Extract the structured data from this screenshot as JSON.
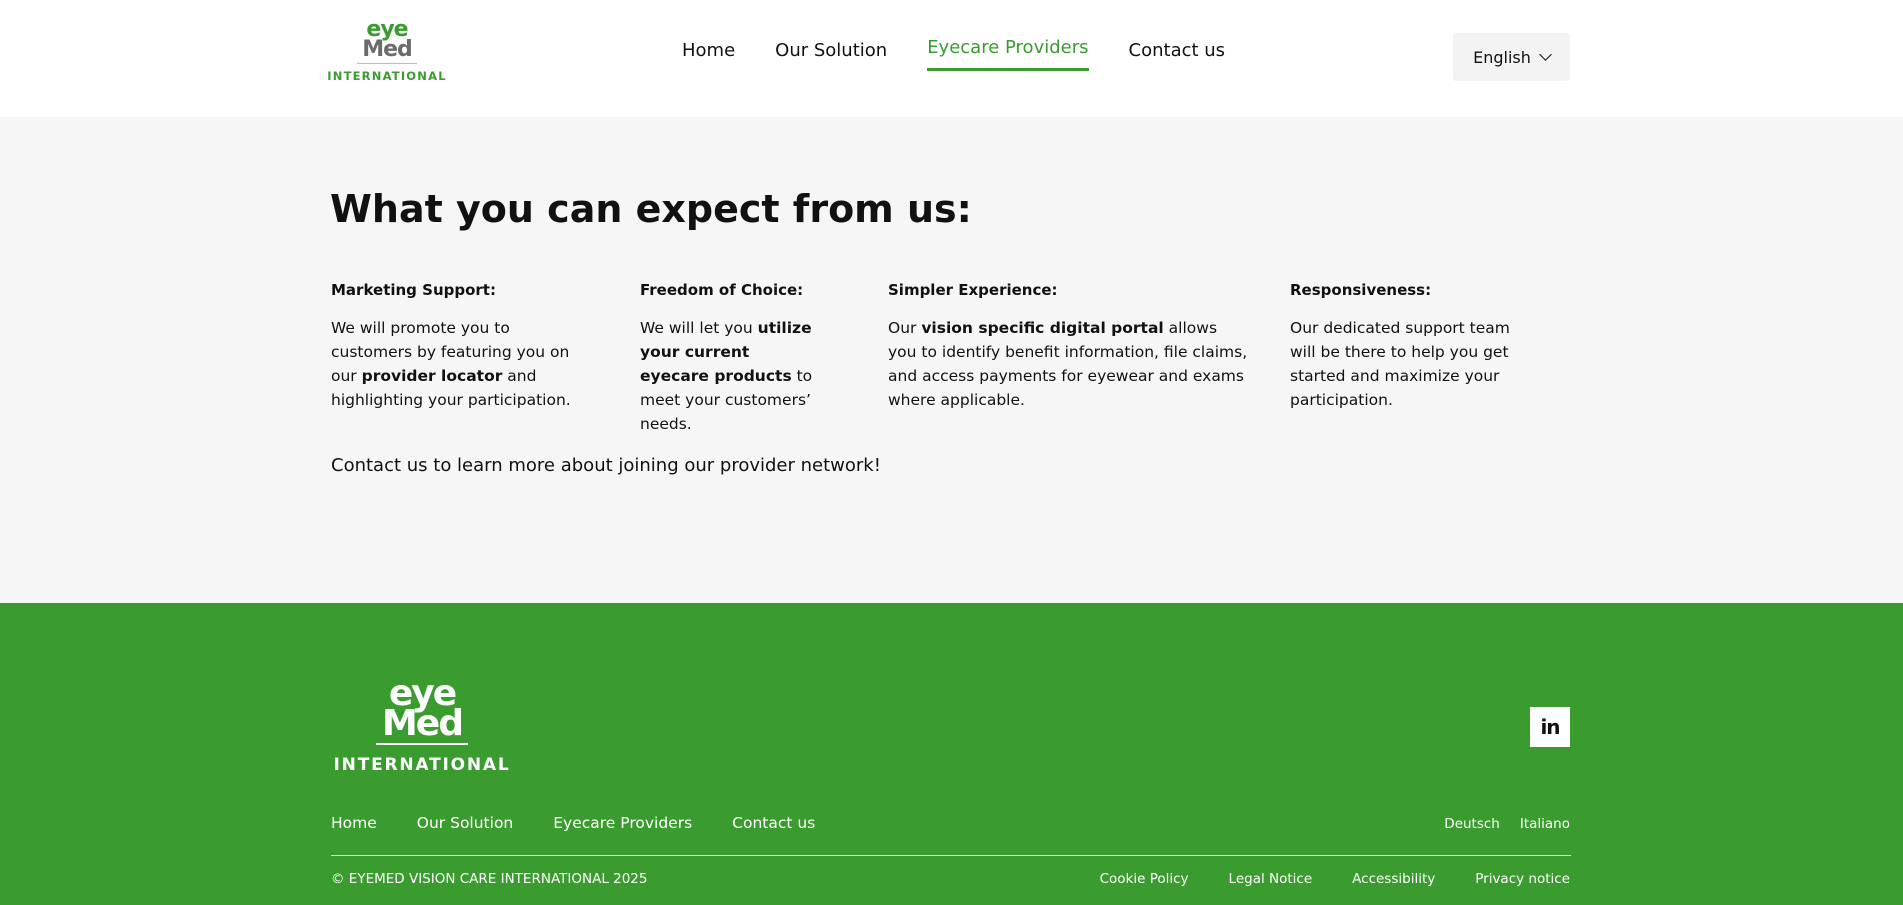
{
  "header": {
    "logo": {
      "line1": "eye",
      "line2": "Med",
      "line3": "INTERNATIONAL"
    },
    "nav": [
      {
        "label": "Home",
        "active": false
      },
      {
        "label": "Our Solution",
        "active": false
      },
      {
        "label": "Eyecare Providers",
        "active": true
      },
      {
        "label": "Contact us",
        "active": false
      }
    ],
    "language": {
      "selected": "English",
      "icon": "chevron-down-icon"
    }
  },
  "main": {
    "title": "What you can expect from us:",
    "columns": [
      {
        "heading": "Marketing Support:",
        "parts": [
          {
            "text": "We will promote you to customers by featuring you on our ",
            "bold": false
          },
          {
            "text": "provider locator",
            "bold": true
          },
          {
            "text": " and highlighting your participation.",
            "bold": false
          }
        ]
      },
      {
        "heading": "Freedom of Choice:",
        "parts": [
          {
            "text": "We will let you ",
            "bold": false
          },
          {
            "text": "utilize your current eyecare products",
            "bold": true
          },
          {
            "text": " to meet your customers’ needs.",
            "bold": false
          }
        ]
      },
      {
        "heading": "Simpler Experience:",
        "parts": [
          {
            "text": "Our ",
            "bold": false
          },
          {
            "text": "vision specific digital portal",
            "bold": true
          },
          {
            "text": " allows you to identify benefit information, file claims, and access payments for eyewear and exams where applicable.",
            "bold": false
          }
        ]
      },
      {
        "heading": "Responsiveness:",
        "parts": [
          {
            "text": "Our dedicated support team will be there to help you get started and maximize your participation.",
            "bold": false
          }
        ]
      }
    ],
    "cta": "Contact us to learn more about joining our provider network!"
  },
  "footer": {
    "logo": {
      "line1": "eye",
      "line2": "Med",
      "line3": "INTERNATIONAL"
    },
    "social": {
      "label": "in",
      "icon": "linkedin-icon"
    },
    "nav": [
      "Home",
      "Our Solution",
      "Eyecare Providers",
      "Contact us"
    ],
    "languages": [
      "Deutsch",
      "Italiano"
    ],
    "copyright": "© EYEMED VISION CARE INTERNATIONAL 2025",
    "legal": [
      "Cookie Policy",
      "Legal Notice",
      "Accessibility",
      "Privacy notice"
    ]
  },
  "colors": {
    "brand_green": "#3a9b2f",
    "main_bg": "#f6f6f6",
    "text": "#111111"
  }
}
